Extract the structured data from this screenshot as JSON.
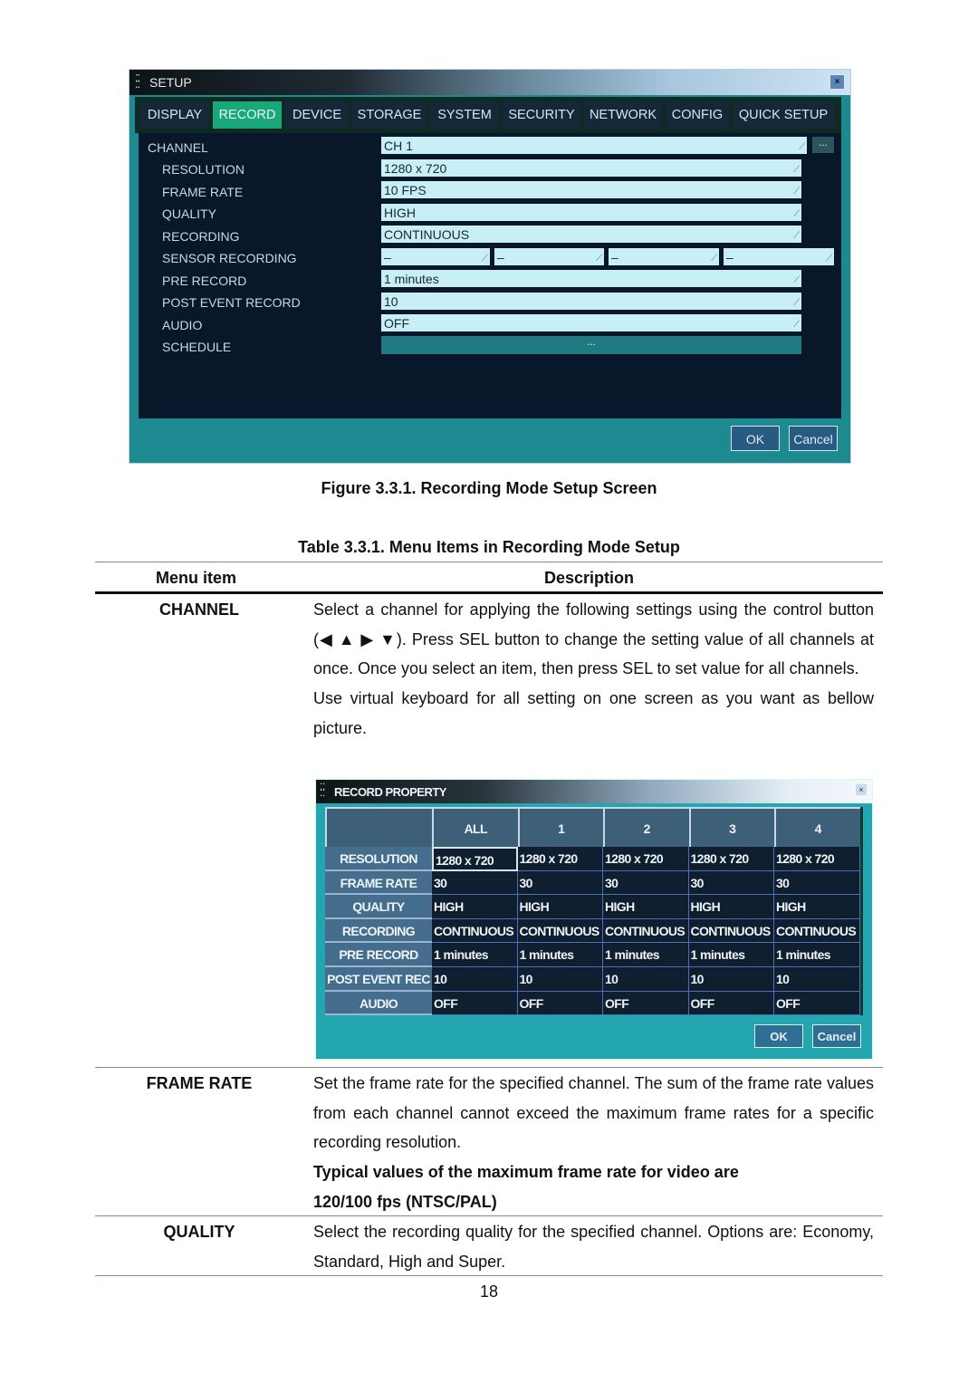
{
  "setup_screen": {
    "title": "SETUP",
    "close_label": "×",
    "tabs": [
      {
        "label": "DISPLAY",
        "active": false
      },
      {
        "label": "RECORD",
        "active": true
      },
      {
        "label": "DEVICE",
        "active": false
      },
      {
        "label": "STORAGE",
        "active": false
      },
      {
        "label": "SYSTEM",
        "active": false
      },
      {
        "label": "SECURITY",
        "active": false
      },
      {
        "label": "NETWORK",
        "active": false
      },
      {
        "label": "CONFIG",
        "active": false
      },
      {
        "label": "QUICK SETUP",
        "active": false
      }
    ],
    "fields": {
      "channel": {
        "label": "CHANNEL",
        "value": "CH 1",
        "more_label": "..."
      },
      "resolution": {
        "label": "RESOLUTION",
        "value": "1280 x 720"
      },
      "frame_rate": {
        "label": "FRAME RATE",
        "value": "10 FPS"
      },
      "quality": {
        "label": "QUALITY",
        "value": "HIGH"
      },
      "recording": {
        "label": "RECORDING",
        "value": "CONTINUOUS"
      },
      "sensor_recording": {
        "label": "SENSOR RECORDING",
        "values": [
          "–",
          "–",
          "–",
          "–"
        ]
      },
      "pre_record": {
        "label": "PRE RECORD",
        "value": "1 minutes"
      },
      "post_event_record": {
        "label": "POST EVENT RECORD",
        "value": "10"
      },
      "audio": {
        "label": "AUDIO",
        "value": "OFF"
      },
      "schedule": {
        "label": "SCHEDULE",
        "value": "..."
      }
    },
    "dropdown_glyph": "⁄",
    "ok_label": "OK",
    "cancel_label": "Cancel"
  },
  "figure_caption": "Figure 3.3.1. Recording Mode Setup Screen",
  "table": {
    "caption": "Table 3.3.1. Menu Items in Recording Mode Setup",
    "headers": {
      "item": "Menu item",
      "description": "Description"
    },
    "rows": [
      {
        "item": "CHANNEL",
        "paragraphs": [
          "Select a channel for applying the following settings using the control button (◀ ▲ ▶ ▼). Press SEL button to change the setting value of all channels at once. Once you select an item, then press SEL to set value for all channels.",
          "Use virtual keyboard for all setting on one screen as you want as bellow picture."
        ]
      },
      {
        "item": "FRAME RATE",
        "paragraphs": [
          "Set the frame rate for the specified channel. The sum of the frame rate values from each channel cannot exceed the maximum frame rates for a specific recording resolution."
        ],
        "bold_note": [
          "Typical values of the maximum frame rate for video are",
          "120/100 fps (NTSC/PAL)"
        ]
      },
      {
        "item": "QUALITY",
        "paragraphs": [
          "Select the recording quality for the specified channel. Options are: Economy, Standard, High and Super."
        ]
      }
    ]
  },
  "record_property": {
    "title": "RECORD PROPERTY",
    "close_label": "×",
    "columns": [
      "ALL",
      "1",
      "2",
      "3",
      "4"
    ],
    "rows": [
      {
        "label": "RESOLUTION",
        "values": [
          "1280 x 720",
          "1280 x 720",
          "1280 x 720",
          "1280 x 720",
          "1280 x 720"
        ]
      },
      {
        "label": "FRAME RATE",
        "values": [
          "30",
          "30",
          "30",
          "30",
          "30"
        ]
      },
      {
        "label": "QUALITY",
        "values": [
          "HIGH",
          "HIGH",
          "HIGH",
          "HIGH",
          "HIGH"
        ]
      },
      {
        "label": "RECORDING",
        "values": [
          "CONTINUOUS",
          "CONTINUOUS",
          "CONTINUOUS",
          "CONTINUOUS",
          "CONTINUOUS"
        ]
      },
      {
        "label": "PRE RECORD",
        "values": [
          "1 minutes",
          "1 minutes",
          "1 minutes",
          "1 minutes",
          "1 minutes"
        ]
      },
      {
        "label": "POST EVENT REC",
        "values": [
          "10",
          "10",
          "10",
          "10",
          "10"
        ]
      },
      {
        "label": "AUDIO",
        "values": [
          "OFF",
          "OFF",
          "OFF",
          "OFF",
          "OFF"
        ]
      }
    ],
    "ok_label": "OK",
    "cancel_label": "Cancel"
  },
  "page_number": "18",
  "colors": {
    "active_tab": "#1aa77a",
    "window_frame": "#1d8a92",
    "panel_bg": "#08182a",
    "field_bg": "#c8eef6"
  }
}
